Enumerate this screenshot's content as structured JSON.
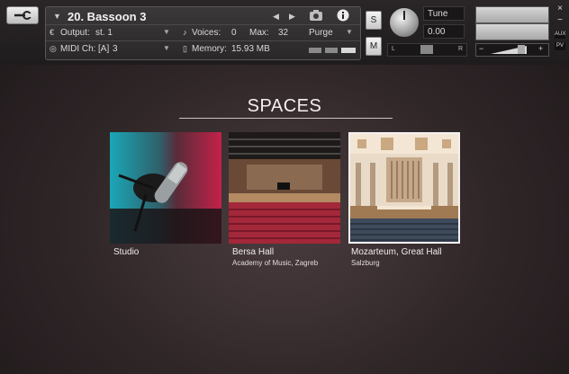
{
  "header": {
    "instrument_name": "20. Bassoon 3",
    "output_label": "Output:",
    "output_value": "st. 1",
    "voices_label": "Voices:",
    "voices_value": "0",
    "max_label": "Max:",
    "max_value": "32",
    "purge_label": "Purge",
    "midi_label": "MIDI Ch:",
    "midi_port": "[A]",
    "midi_value": "3",
    "memory_label": "Memory:",
    "memory_value": "15.93 MB",
    "solo_label": "S",
    "mute_label": "M",
    "tune_label": "Tune",
    "tune_value": "0.00",
    "pan_left": "L",
    "pan_right": "R",
    "aux_label": "AUX",
    "pv_label": "PV",
    "close_glyph": "×",
    "minus_glyph": "−",
    "plus_glyph": "+"
  },
  "main": {
    "title": "SPACES",
    "spaces": [
      {
        "name": "Studio",
        "location": ""
      },
      {
        "name": "Bersa Hall",
        "location": "Academy of Music, Zagreb"
      },
      {
        "name": "Mozarteum, Great Hall",
        "location": "Salzburg"
      }
    ]
  }
}
